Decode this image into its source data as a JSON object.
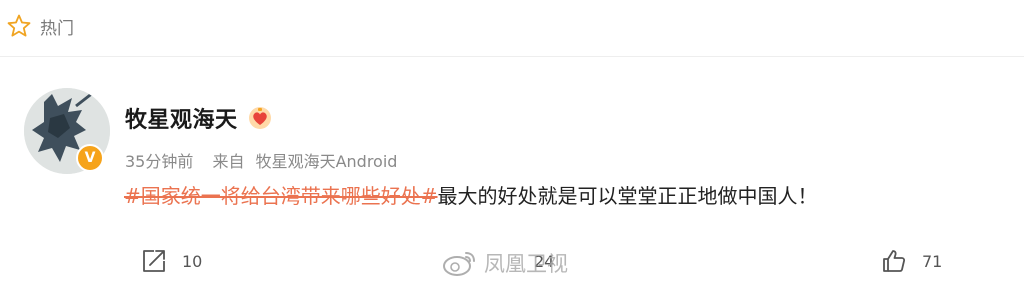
{
  "header": {
    "hot_label": "热门"
  },
  "post": {
    "username": "牧星观海天",
    "verified_badge": "V",
    "time": "35分钟前",
    "source_label": "来自",
    "source_name": "牧星观海天Android",
    "hashtag": "#国家统一将给台湾带来哪些好处#",
    "text": "最大的好处就是可以堂堂正正地做中国人！"
  },
  "actions": {
    "repost_count": "10",
    "comment_count": "24",
    "like_count": "71"
  },
  "watermark": {
    "text": "凤凰卫视"
  },
  "colors": {
    "hashtag": "#eb7350",
    "verified": "#f6a31a",
    "meta": "#8a8a8a"
  }
}
